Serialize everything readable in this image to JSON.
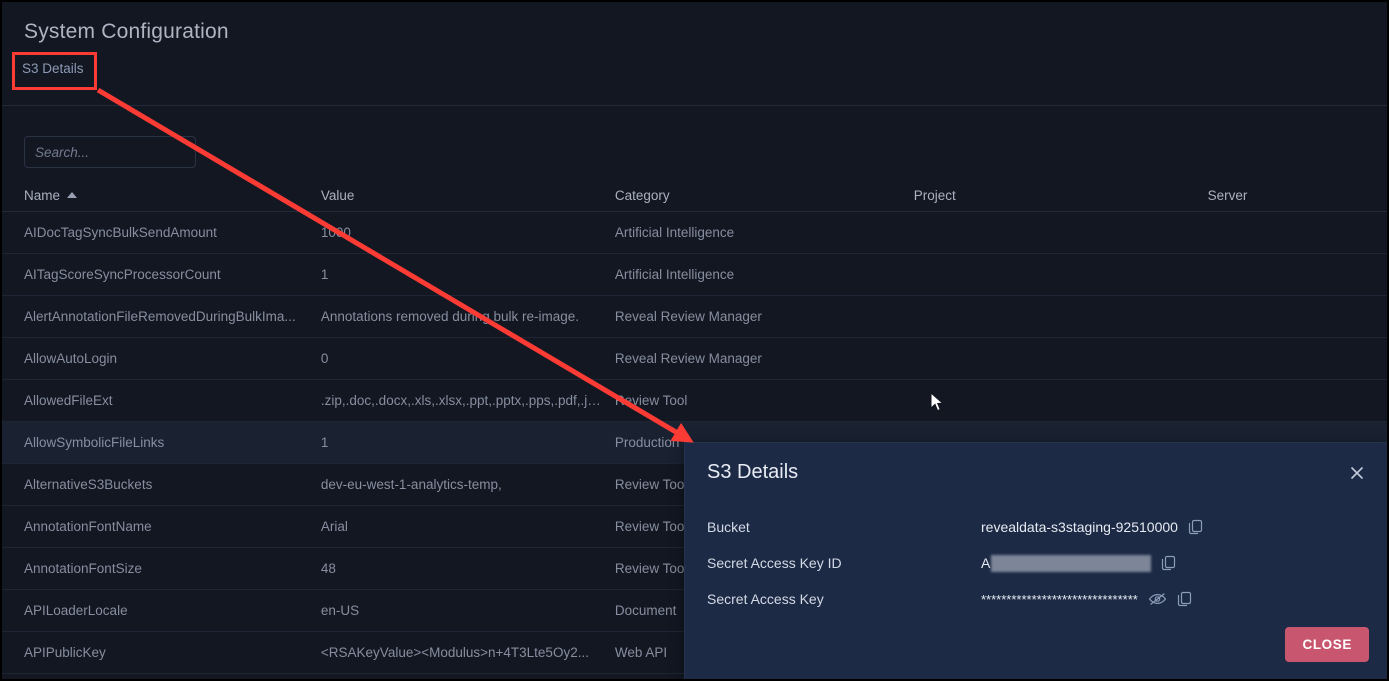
{
  "header": {
    "title": "System Configuration",
    "s3_details_link": "S3 Details"
  },
  "search": {
    "placeholder": "Search...",
    "value": ""
  },
  "table": {
    "columns": [
      "Name",
      "Value",
      "Category",
      "Project",
      "Server"
    ],
    "sorted_column": "Name",
    "sort_direction": "asc",
    "rows": [
      {
        "name": "AIDocTagSyncBulkSendAmount",
        "value": "1000",
        "category": "Artificial Intelligence",
        "project": "",
        "server": ""
      },
      {
        "name": "AITagScoreSyncProcessorCount",
        "value": "1",
        "category": "Artificial Intelligence",
        "project": "",
        "server": ""
      },
      {
        "name": "AlertAnnotationFileRemovedDuringBulkIma...",
        "value": "Annotations removed during bulk re-image.",
        "category": "Reveal Review Manager",
        "project": "",
        "server": ""
      },
      {
        "name": "AllowAutoLogin",
        "value": "0",
        "category": "Reveal Review Manager",
        "project": "",
        "server": ""
      },
      {
        "name": "AllowedFileExt",
        "value": ".zip,.doc,.docx,.xls,.xlsx,.ppt,.pptx,.pps,.pdf,.jp...",
        "category": "Review Tool",
        "project": "",
        "server": ""
      },
      {
        "name": "AllowSymbolicFileLinks",
        "value": "1",
        "category": "Production",
        "project": "",
        "server": ""
      },
      {
        "name": "AlternativeS3Buckets",
        "value": "dev-eu-west-1-analytics-temp,",
        "category": "Review Tool",
        "project": "",
        "server": ""
      },
      {
        "name": "AnnotationFontName",
        "value": "Arial",
        "category": "Review Tool",
        "project": "",
        "server": ""
      },
      {
        "name": "AnnotationFontSize",
        "value": "48",
        "category": "Review Tool",
        "project": "",
        "server": ""
      },
      {
        "name": "APILoaderLocale",
        "value": "en-US",
        "category": "Document",
        "project": "",
        "server": ""
      },
      {
        "name": "APIPublicKey",
        "value": "<RSAKeyValue><Modulus>n+4T3Lte5Oy2...",
        "category": "Web API",
        "project": "",
        "server": ""
      }
    ]
  },
  "dialog": {
    "title": "S3 Details",
    "close_icon": "close-icon",
    "fields": [
      {
        "label": "Bucket",
        "value": "revealdata-s3staging-92510000",
        "kind": "text",
        "copy_icon": "copy-icon"
      },
      {
        "label": "Secret Access Key ID",
        "value": "A",
        "kind": "redacted",
        "copy_icon": "copy-icon"
      },
      {
        "label": "Secret Access Key",
        "value": "*******************************",
        "kind": "masked",
        "reveal_icon": "eye-off-icon",
        "copy_icon": "copy-icon"
      }
    ],
    "close_button": "CLOSE"
  },
  "colors": {
    "page_background": "#121722",
    "dialog_background": "#1c2a45",
    "close_button": "#c8566f",
    "annotation": "#fc3b34",
    "link": "#8d9ab5"
  }
}
